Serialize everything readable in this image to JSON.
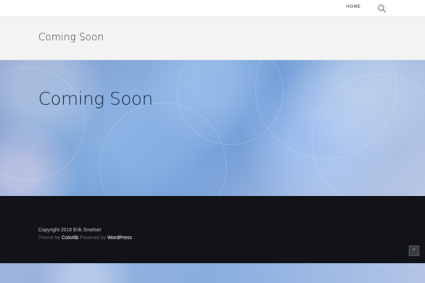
{
  "nav": {
    "home_label": "HOME",
    "search_icon": "search-icon"
  },
  "page": {
    "title": "Coming Soon"
  },
  "hero": {
    "title": "Coming Soon"
  },
  "footer": {
    "copyright": "Copyright 2016 Erik Smelser",
    "theme_by": "Theme by",
    "theme_link": "Colorlib",
    "powered_by": "Powered by",
    "powered_link": "WordPress",
    "scroll_top_icon": "chevron-up-icon",
    "scroll_top_glyph": "^"
  },
  "colors": {
    "footer_bg": "#121318",
    "titlebar_bg": "#f3f3f3"
  }
}
